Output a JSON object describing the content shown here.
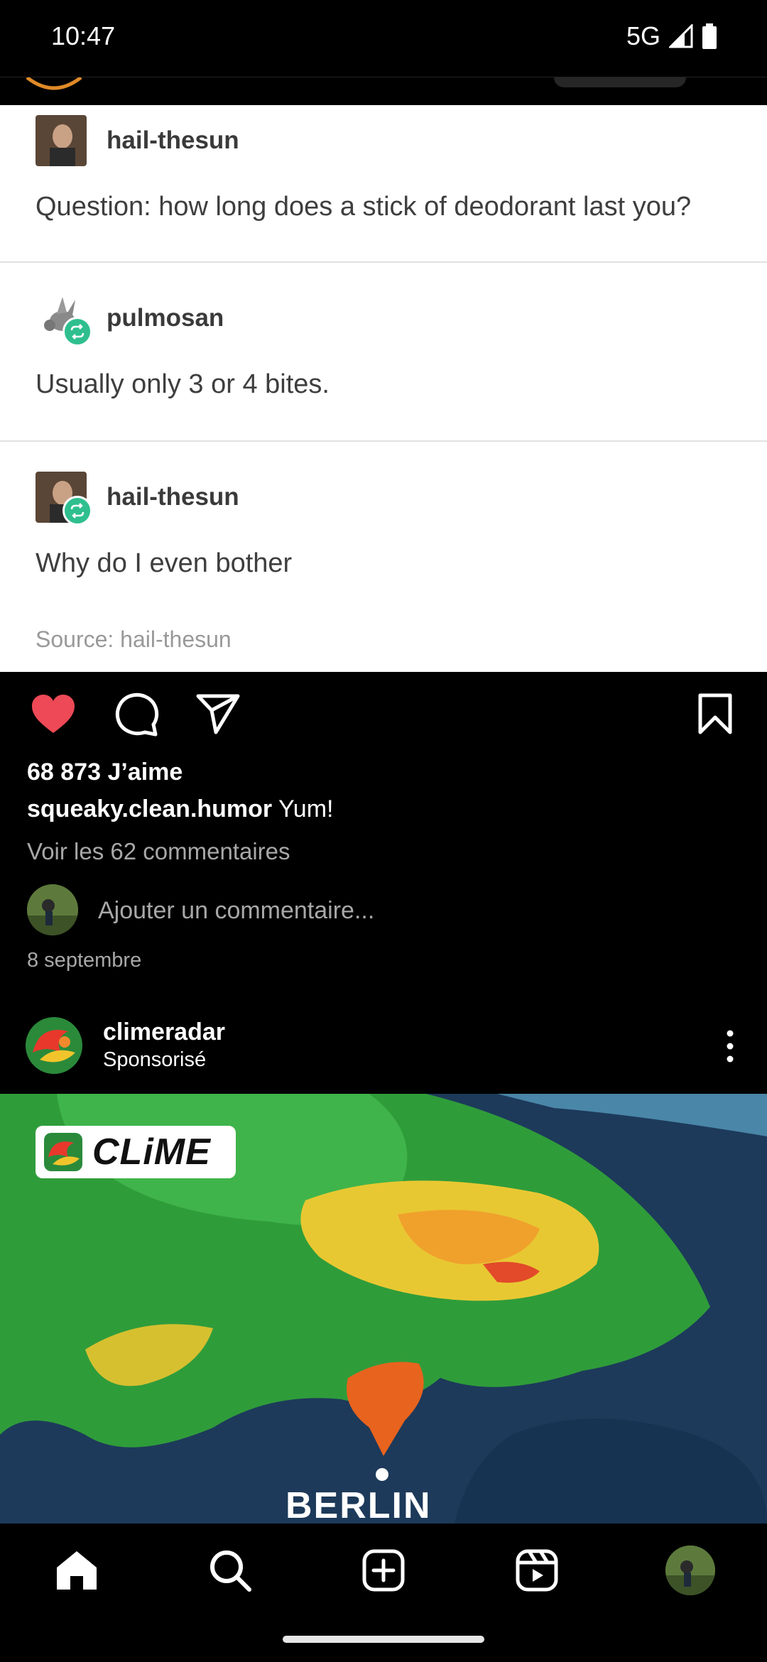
{
  "status_bar": {
    "time": "10:47",
    "network": "5G"
  },
  "tumblr_posts": [
    {
      "username": "hail-thesun",
      "text": "Question: how long does a stick of deodorant last you?"
    },
    {
      "username": "pulmosan",
      "text": "Usually only 3 or 4 bites."
    },
    {
      "username": "hail-thesun",
      "text": "Why do I even bother"
    }
  ],
  "tumblr_source": "Source: hail-thesun",
  "post": {
    "likes": "68 873 J’aime",
    "caption_user": "squeaky.clean.humor",
    "caption_text": " Yum!",
    "view_comments": "Voir les 62 commentaires",
    "comment_placeholder": "Ajouter un commentaire...",
    "date": "8 septembre",
    "liked": true
  },
  "sponsored": {
    "username": "climeradar",
    "label": "Sponsorisé",
    "ad_logo_text": "CLiME",
    "ad_city": "BERLIN"
  },
  "colors": {
    "like_red": "#ed4956",
    "reblog_green": "#2fbf8f"
  },
  "bottom_nav": [
    "home-icon",
    "search-icon",
    "create-icon",
    "reels-icon",
    "profile-avatar"
  ]
}
